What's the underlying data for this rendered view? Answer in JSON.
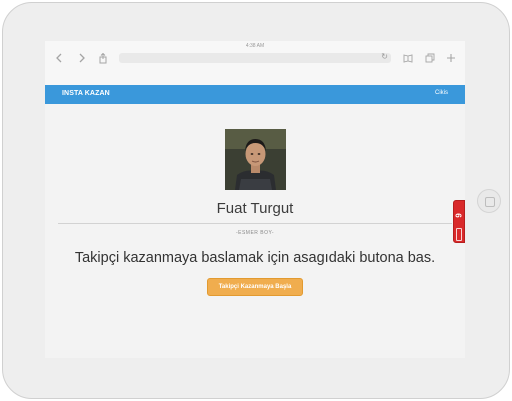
{
  "browser": {
    "status_time": "4:38 AM",
    "back_icon": "chevron-left-icon",
    "forward_icon": "chevron-right-icon",
    "share_icon": "share-icon",
    "reload_icon": "reload-icon",
    "bookmarks_icon": "book-icon",
    "tabs_icon": "tabs-icon",
    "new_tab_icon": "plus-icon"
  },
  "app": {
    "title": "INSTA KAZAN",
    "logout_label": "Cikis",
    "accent_color": "#3a98db"
  },
  "profile": {
    "name": "Fuat Turgut",
    "bio": "-ESMER BOY-"
  },
  "main": {
    "prompt": "Takipçi kazanmaya baslamak için asagıdaki butona bas.",
    "start_button_label": "Takipçi Kazanmaya Başla",
    "button_color": "#f0ad4e"
  },
  "side_tab": {
    "label": "6",
    "color": "#d9292a"
  }
}
